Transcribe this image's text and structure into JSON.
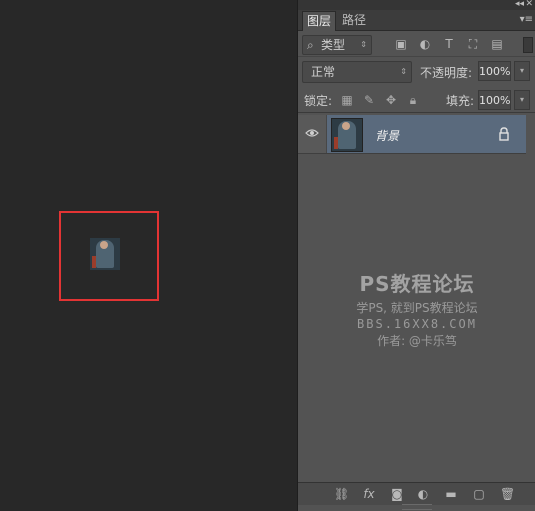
{
  "panel": {
    "tabs": [
      {
        "label": "图层"
      },
      {
        "label": "路径"
      }
    ],
    "filter": {
      "label": "类型"
    },
    "blend": {
      "mode": "正常",
      "opacity_label": "不透明度:",
      "opacity_value": "100%"
    },
    "lock": {
      "label": "锁定:",
      "fill_label": "填充:",
      "fill_value": "100%"
    },
    "layers": [
      {
        "name": "背景",
        "visible": true,
        "locked": true,
        "selected": true
      }
    ],
    "watermark": {
      "title": "PS教程论坛",
      "subtitle": "学PS, 就到PS教程论坛",
      "url": "BBS.16XX8.COM",
      "author": "作者: @卡乐笃"
    }
  },
  "colors": {
    "canvas_bg": "#282828",
    "panel_bg": "#535353",
    "selected_layer": "#5a6a7d",
    "selection_box": "#e33434"
  },
  "icons": [
    "search-icon",
    "pixel-filter-icon",
    "adjustment-filter-icon",
    "type-filter-icon",
    "shape-filter-icon",
    "smart-object-filter-icon",
    "lock-transparent-icon",
    "lock-paint-icon",
    "lock-move-icon",
    "lock-all-icon",
    "eye-icon",
    "lock-icon",
    "link-icon",
    "fx-icon",
    "mask-icon",
    "adjustment-icon",
    "folder-icon",
    "new-layer-icon",
    "trash-icon"
  ]
}
